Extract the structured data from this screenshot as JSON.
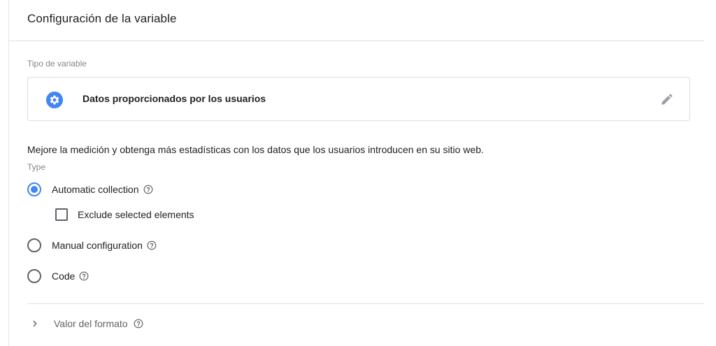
{
  "header": {
    "title": "Configuración de la variable"
  },
  "variable_type": {
    "label": "Tipo de variable",
    "name": "Datos proporcionados por los usuarios",
    "icon": "gear-icon",
    "icon_color": "#4285f4"
  },
  "description": "Mejore la medición y obtenga más estadísticas con los datos que los usuarios introducen en su sitio web.",
  "type_section": {
    "label": "Type",
    "options": [
      {
        "label": "Automatic collection",
        "selected": true
      },
      {
        "label": "Manual configuration",
        "selected": false
      },
      {
        "label": "Code",
        "selected": false
      }
    ],
    "exclude_checkbox": {
      "label": "Exclude selected elements",
      "checked": false
    }
  },
  "format_value": {
    "label": "Valor del formato"
  },
  "colors": {
    "accent": "#4285f4",
    "text": "#202124",
    "muted": "#80868b"
  }
}
